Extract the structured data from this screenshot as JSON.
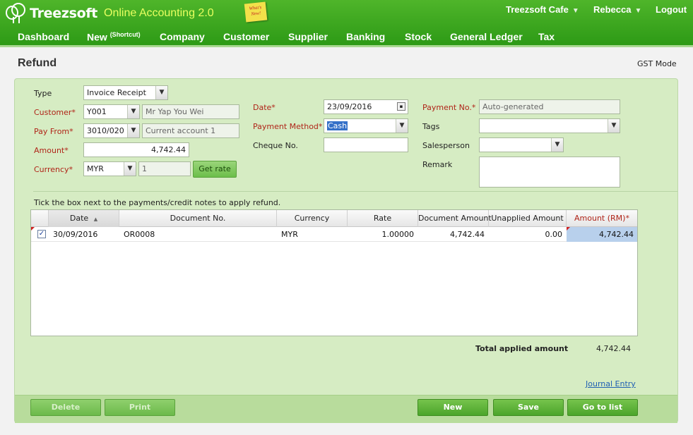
{
  "header": {
    "logo_text": "Treezsoft",
    "app_title": "Online Accounting 2.0",
    "sticky_note": "What's New!",
    "company": "Treezsoft Cafe",
    "user": "Rebecca",
    "logout": "Logout"
  },
  "nav": {
    "items": [
      "Dashboard",
      "New",
      "Company",
      "Customer",
      "Supplier",
      "Banking",
      "Stock",
      "General Ledger",
      "Tax"
    ],
    "new_sup": "(Shortcut)"
  },
  "page": {
    "title": "Refund",
    "gst_mode": "GST Mode"
  },
  "form": {
    "type_label": "Type",
    "type_value": "Invoice Receipt",
    "customer_label": "Customer*",
    "customer_code": "Y001",
    "customer_name": "Mr Yap You Wei",
    "payfrom_label": "Pay From*",
    "payfrom_code": "3010/020",
    "payfrom_name": "Current account 1",
    "amount_label": "Amount*",
    "amount_value": "4,742.44",
    "currency_label": "Currency*",
    "currency_value": "MYR",
    "rate_value": "1",
    "get_rate": "Get rate",
    "date_label": "Date*",
    "date_value": "23/09/2016",
    "method_label": "Payment Method*",
    "method_value": "Cash",
    "cheque_label": "Cheque No.",
    "cheque_value": "",
    "payno_label": "Payment No.*",
    "payno_value": "Auto-generated",
    "tags_label": "Tags",
    "tags_value": "",
    "salesperson_label": "Salesperson",
    "salesperson_value": "",
    "remark_label": "Remark",
    "remark_value": ""
  },
  "grid": {
    "instruction": "Tick the box next to the payments/credit notes to apply refund.",
    "headers": [
      "Date",
      "Document No.",
      "Currency",
      "Rate",
      "Document Amount",
      "Unapplied Amount",
      "Amount (RM)*"
    ],
    "sort_indicator": "▲",
    "rows": [
      {
        "checked": "✓",
        "date": "30/09/2016",
        "doc": "OR0008",
        "currency": "MYR",
        "rate": "1.00000",
        "doc_amount": "4,742.44",
        "unapplied": "0.00",
        "amount": "4,742.44"
      }
    ]
  },
  "totals": {
    "label": "Total applied amount",
    "value": "4,742.44"
  },
  "journal_link": "Journal Entry",
  "buttons": {
    "delete": "Delete",
    "print": "Print",
    "new": "New",
    "save": "Save",
    "go_to_list": "Go to list"
  },
  "colors": {
    "brand_green": "#3aa61f",
    "panel": "#d6ecc3",
    "required": "#b02418"
  }
}
